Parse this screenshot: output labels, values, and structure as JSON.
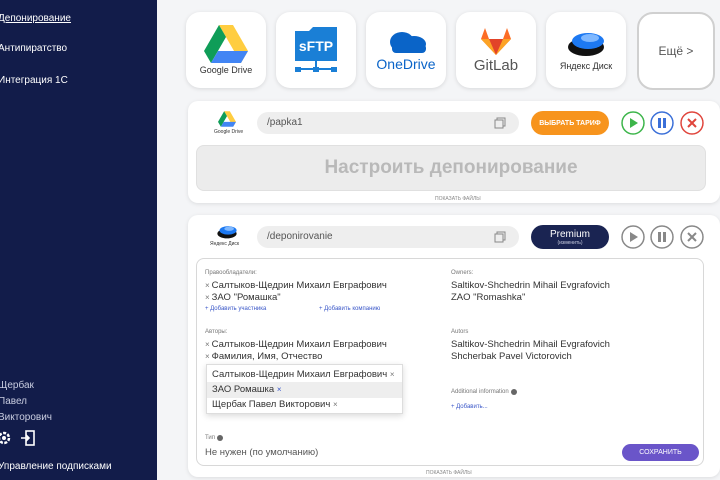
{
  "sidebar": {
    "items": [
      {
        "label": "Депонирование"
      },
      {
        "label": "Антипиратство"
      },
      {
        "label": "Интеграция 1С"
      }
    ],
    "user": {
      "line1": "Щербак",
      "line2": "Павел",
      "line3": "Викторович"
    },
    "manage_label": "Управление подписками",
    "icons": [
      "gear-icon",
      "logout-icon"
    ]
  },
  "services": [
    {
      "label": "Google Drive",
      "icon": "google-drive-icon"
    },
    {
      "label": "",
      "icon": "sftp-icon",
      "logo_text": "sFTP"
    },
    {
      "label": "OneDrive",
      "icon": "onedrive-icon"
    },
    {
      "label": "GitLab",
      "icon": "gitlab-icon"
    },
    {
      "label": "Яндекс Диск",
      "icon": "yandex-disk-icon"
    }
  ],
  "more_label": "Ещё >",
  "card1": {
    "logo_label": "Google Drive",
    "path": "/papka1",
    "tariff_label": "ВЫБРАТЬ ТАРИФ",
    "setup_label": "Настроить депонирование",
    "show_files": "ПОКАЗАТЬ ФАЙЛЫ"
  },
  "card2": {
    "logo_label": "Яндекс Диск",
    "path": "/deponirovanie",
    "premium_label": "Premium",
    "premium_sub": "(изменить)",
    "show_files": "ПОКАЗАТЬ ФАЙЛЫ"
  },
  "form": {
    "rights_label": "Правообладатели:",
    "rights": [
      "Салтыков-Щедрин Михаил Евграфович",
      "ЗАО \"Ромашка\""
    ],
    "add_participant": "+ Добавить участника",
    "add_company": "+ Добавить компанию",
    "owners_label": "Owners:",
    "owners": [
      "Saltikov-Shchedrin Mihail Evgrafovich",
      "ZAO \"Romashka\""
    ],
    "authors_label": "Авторы:",
    "authors": [
      "Салтыков-Щедрин Михаил Евграфович",
      "Фамилия, Имя, Отчество"
    ],
    "autors_label": "Autors",
    "autors": [
      "Saltikov-Shchedrin Mihail Evgrafovich",
      "Shcherbak Pavel Victorovich"
    ],
    "dropdown": [
      "Салтыков-Щедрин Михаил Евграфович",
      "ЗАО Ромашка",
      "Щербак Павел Викторович"
    ],
    "additional_label": "Additional information",
    "add_more": "+ Добавить...",
    "type_label": "Тип",
    "type_value": "Не нужен (по умолчанию)",
    "save_label": "СОХРАНИТЬ"
  },
  "colors": {
    "sidebar": "#121c4a",
    "tariff": "#f7941d",
    "premium": "#1a2452",
    "save": "#6a55c9",
    "play": "#3cb54a",
    "pause": "#3a6fd8",
    "stop": "#e0453c"
  }
}
